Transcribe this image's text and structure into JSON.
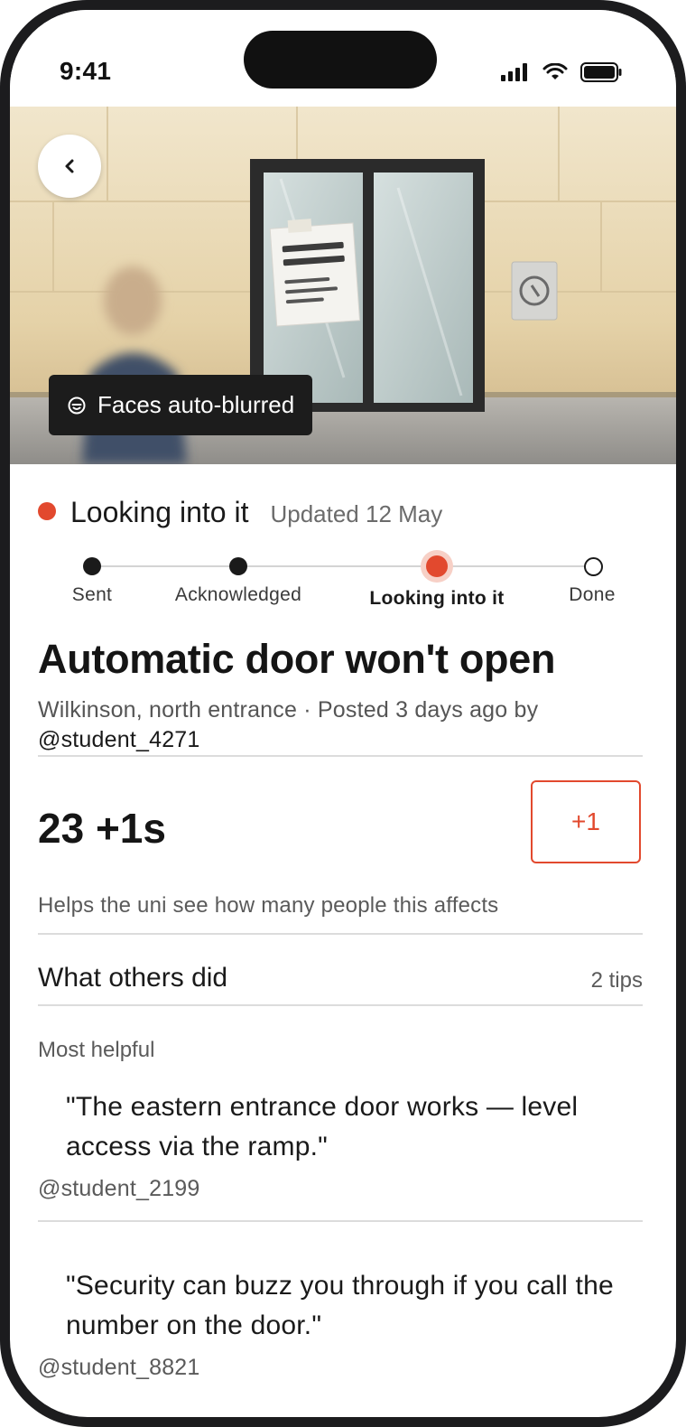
{
  "status_bar": {
    "time": "9:41"
  },
  "hero": {
    "back_icon": "chevron-left-icon",
    "privacy_badge": {
      "icon": "face-icon",
      "label": "Faces auto-blurred"
    }
  },
  "report": {
    "status": {
      "label": "Looking into it",
      "updated": "Updated 12 May",
      "color": "#e2492e"
    },
    "progress": {
      "steps": [
        {
          "label": "Sent",
          "state": "complete"
        },
        {
          "label": "Acknowledged",
          "state": "complete"
        },
        {
          "label": "Looking into it",
          "state": "current"
        },
        {
          "label": "Done",
          "state": "pending"
        }
      ]
    },
    "title": "Automatic door won't open",
    "meta": "Wilkinson, north entrance · Posted 3 days ago by",
    "author": "@student_4271"
  },
  "votes": {
    "count_label": "23 +1s",
    "button_label": "+1",
    "helper": "Helps the uni see how many people this affects",
    "accent": "#e2492e"
  },
  "tips": {
    "section_title": "What others did",
    "count_label": "2 tips",
    "sort_label": "Most helpful",
    "items": [
      {
        "quote": "\"The eastern entrance door works — level access via the ramp.\"",
        "author": "@student_2199"
      },
      {
        "quote": "\"Security can buzz you through if you call the number on the door.\"",
        "author": "@student_8821"
      }
    ]
  }
}
